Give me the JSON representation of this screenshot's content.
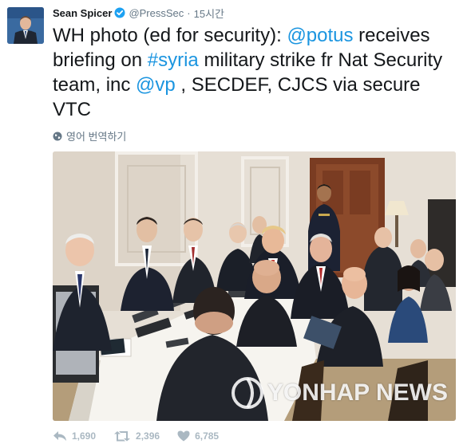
{
  "user": {
    "name": "Sean Spicer",
    "handle": "@PressSec",
    "time": "15시간",
    "separator": "·"
  },
  "tweet": {
    "segments": [
      {
        "text": "WH photo (ed for security): ",
        "type": "plain"
      },
      {
        "text": "@potus",
        "type": "link"
      },
      {
        "text": " receives briefing on ",
        "type": "plain"
      },
      {
        "text": "#syria",
        "type": "link"
      },
      {
        "text": " military strike fr Nat Security team, inc ",
        "type": "plain"
      },
      {
        "text": "@vp",
        "type": "link"
      },
      {
        "text": " , SECDEF, CJCS via secure VTC",
        "type": "plain"
      }
    ]
  },
  "translate": {
    "label": "영어 번역하기",
    "icon": "globe-icon"
  },
  "photo": {
    "watermark": "YONHAP NEWS"
  },
  "actions": {
    "reply_count": "1,690",
    "retweet_count": "2,396",
    "like_count": "6,785"
  },
  "colors": {
    "link": "#1b95e0",
    "verified": "#1da1f2",
    "muted": "#657786",
    "action_gray": "#aab8c2"
  }
}
